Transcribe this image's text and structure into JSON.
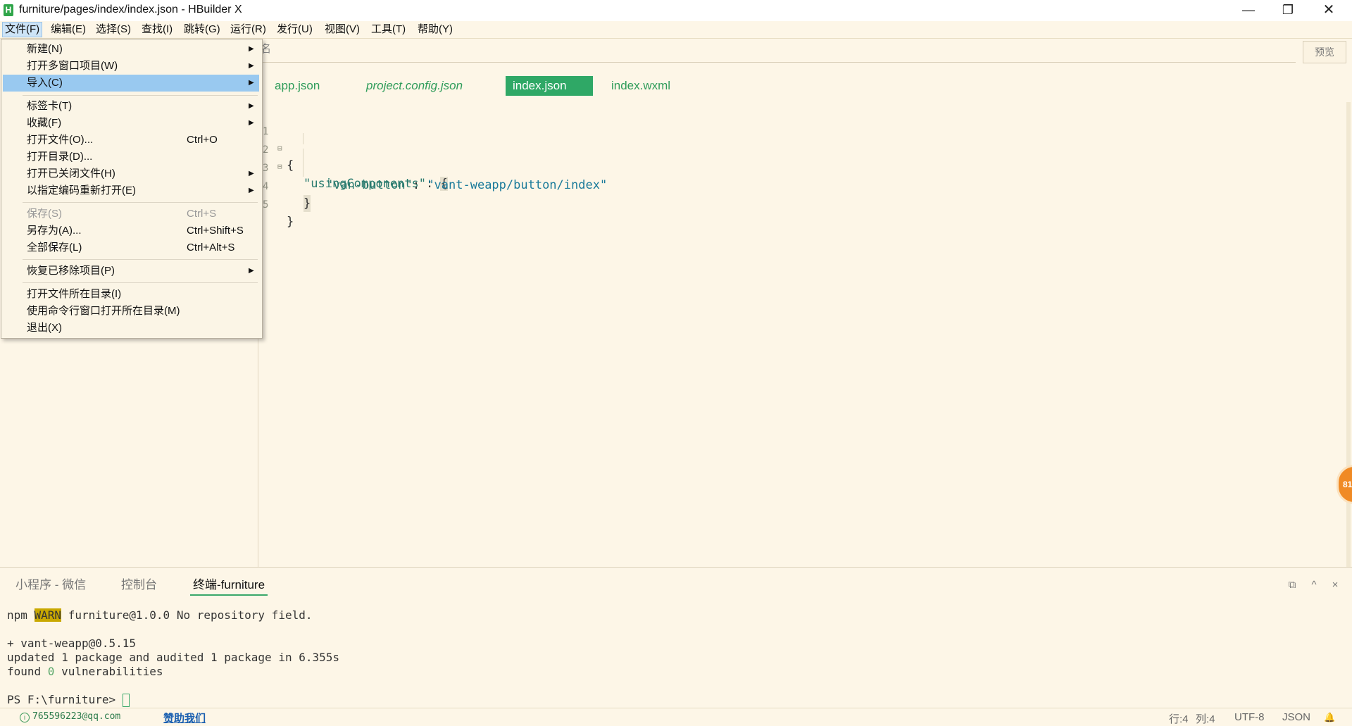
{
  "window": {
    "title": "furniture/pages/index/index.json - HBuilder X",
    "logo_letter": "H",
    "minimize": "—",
    "maximize": "❐",
    "close": "✕"
  },
  "menubar": {
    "items": [
      "文件(F)",
      "编辑(E)",
      "选择(S)",
      "查找(I)",
      "跳转(G)",
      "运行(R)",
      "发行(U)",
      "视图(V)",
      "工具(T)",
      "帮助(Y)"
    ]
  },
  "file_menu": {
    "items": [
      {
        "label": "新建(N)",
        "shortcut": "",
        "submenu": true
      },
      {
        "label": "打开多窗口项目(W)",
        "shortcut": "",
        "submenu": true
      },
      {
        "label": "导入(C)",
        "shortcut": "",
        "submenu": true,
        "highlighted": true
      },
      {
        "label": "标签卡(T)",
        "shortcut": "",
        "submenu": true
      },
      {
        "label": "收藏(F)",
        "shortcut": "",
        "submenu": true
      },
      {
        "label": "打开文件(O)...",
        "shortcut": "Ctrl+O",
        "submenu": false
      },
      {
        "label": "打开目录(D)...",
        "shortcut": "",
        "submenu": false
      },
      {
        "label": "打开已关闭文件(H)",
        "shortcut": "",
        "submenu": true
      },
      {
        "label": "以指定编码重新打开(E)",
        "shortcut": "",
        "submenu": true
      },
      {
        "label": "保存(S)",
        "shortcut": "Ctrl+S",
        "submenu": false,
        "disabled": true
      },
      {
        "label": "另存为(A)...",
        "shortcut": "Ctrl+Shift+S",
        "submenu": false
      },
      {
        "label": "全部保存(L)",
        "shortcut": "Ctrl+Alt+S",
        "submenu": false
      },
      {
        "label": "恢复已移除项目(P)",
        "shortcut": "",
        "submenu": true
      },
      {
        "label": "打开文件所在目录(I)",
        "shortcut": "",
        "submenu": false
      },
      {
        "label": "使用命令行窗口打开所在目录(M)",
        "shortcut": "",
        "submenu": false
      },
      {
        "label": "退出(X)",
        "shortcut": "",
        "submenu": false
      }
    ],
    "submenu_arrow": "▶"
  },
  "address_bar": {
    "visible_text": "名"
  },
  "preview_button": "预览",
  "editor_tabs": [
    {
      "label": "app.json",
      "italic": false,
      "active": false
    },
    {
      "label": "project.config.json",
      "italic": true,
      "active": false
    },
    {
      "label": "index.json",
      "italic": false,
      "active": true
    },
    {
      "label": "index.wxml",
      "italic": false,
      "active": false
    }
  ],
  "editor": {
    "line_numbers": [
      "1",
      "2",
      "3",
      "4",
      "5"
    ],
    "fold_marker": "⊟",
    "code": {
      "l1": "{",
      "l2_key": "\"usingComponents\"",
      "l2_colon": ": ",
      "l2_brace": "{",
      "l3_key": "\"van-button\"",
      "l3_colon": ": ",
      "l3_val": "\"vant-weapp/button/index\"",
      "l4": "}",
      "l5": "}"
    }
  },
  "float_badge": "81",
  "bottom_panel": {
    "tabs": [
      {
        "label": "小程序 - 微信",
        "active": false
      },
      {
        "label": "控制台",
        "active": false
      },
      {
        "label": "终端-furniture",
        "active": true
      }
    ],
    "icons": [
      "restore-icon",
      "chevron-up-icon",
      "close-icon"
    ],
    "icon_glyphs": {
      "restore": "⧉",
      "up": "^",
      "close": "×"
    }
  },
  "terminal": {
    "line1_prefix": "npm ",
    "line1_warn": "WARN",
    "line1_rest": " furniture@1.0.0 No repository field.",
    "line2": "+ vant-weapp@0.5.15",
    "line3": "updated 1 package and audited 1 package in 6.355s",
    "line4_prefix": "found ",
    "line4_num": "0",
    "line4_rest": " vulnerabilities",
    "prompt": "PS F:\\furniture> "
  },
  "statusbar": {
    "user": "765596223@qq.com",
    "sponsor": "赞助我们",
    "line": "行:4",
    "col": "列:4",
    "encoding": "UTF-8",
    "language": "JSON",
    "bell": "🔔"
  }
}
